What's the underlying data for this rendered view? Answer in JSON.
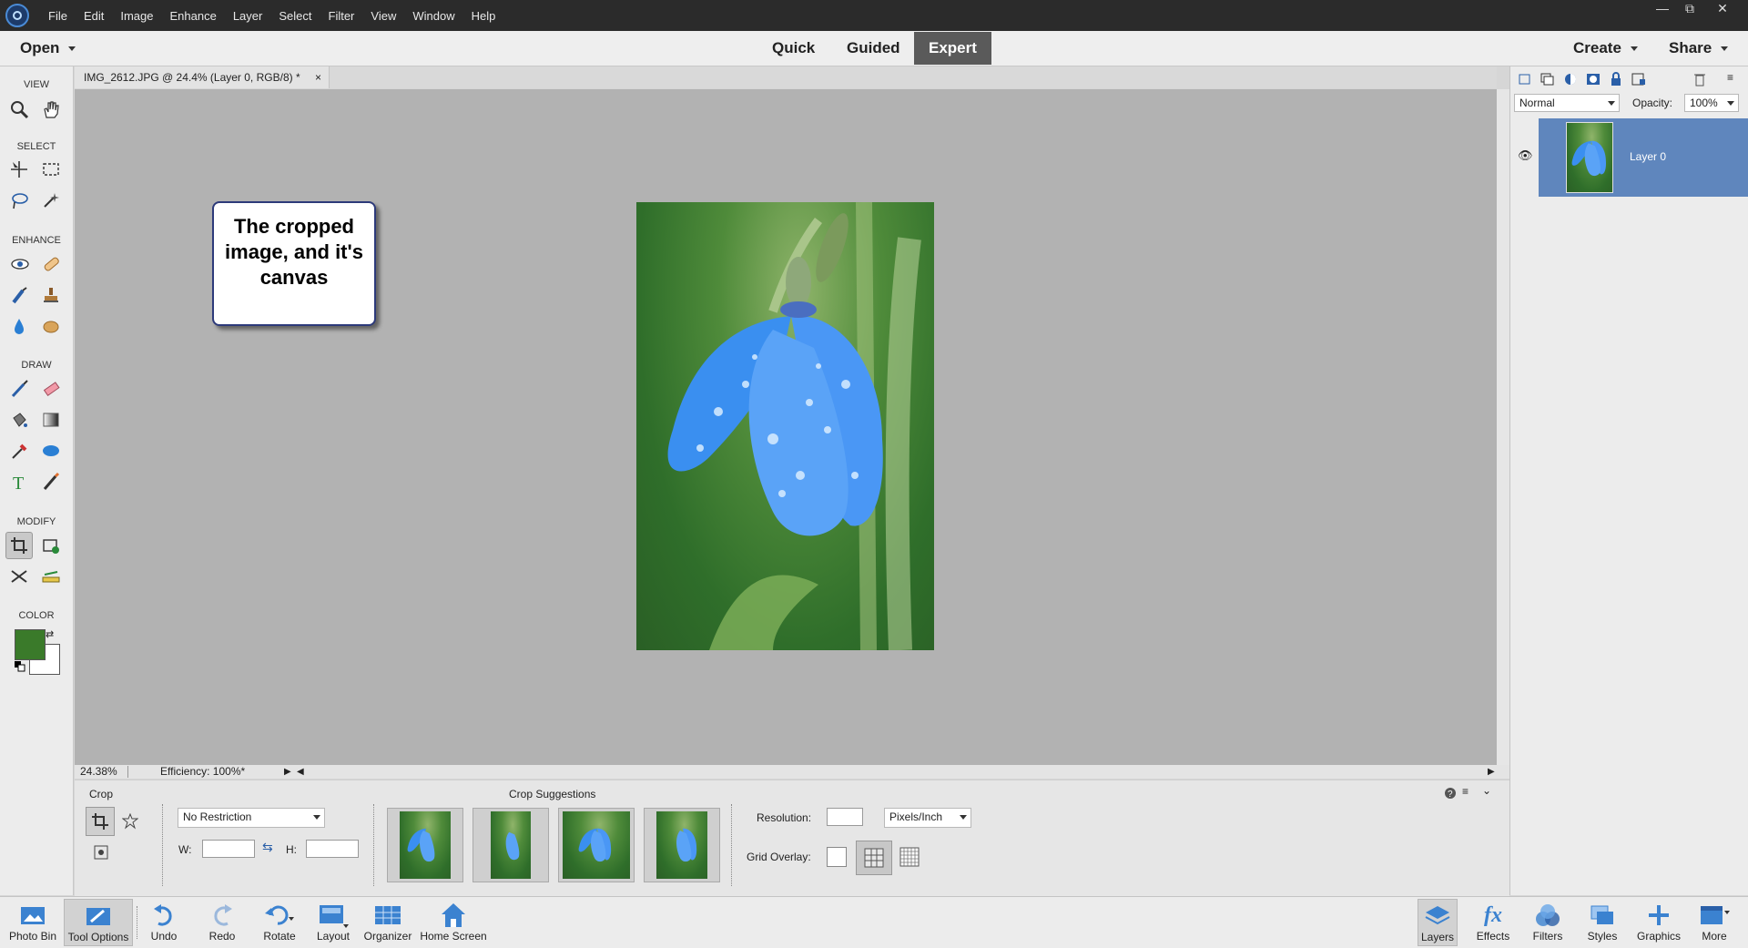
{
  "menubar": {
    "items": [
      "File",
      "Edit",
      "Image",
      "Enhance",
      "Layer",
      "Select",
      "Filter",
      "View",
      "Window",
      "Help"
    ],
    "window_controls": [
      "minimize",
      "restore",
      "close"
    ]
  },
  "modebar": {
    "open_label": "Open",
    "modes": [
      "Quick",
      "Guided",
      "Expert"
    ],
    "active_mode": "Expert",
    "create_label": "Create",
    "share_label": "Share"
  },
  "toolbox": {
    "sections": [
      "VIEW",
      "SELECT",
      "ENHANCE",
      "DRAW",
      "MODIFY",
      "COLOR"
    ],
    "foreground_color": "#3a7a2a",
    "background_color": "#ffffff"
  },
  "document": {
    "tab_title": "IMG_2612.JPG @ 24.4% (Layer 0, RGB/8) *",
    "zoom": "24.38%",
    "efficiency": "Efficiency: 100%*"
  },
  "callout": {
    "text": "The cropped image, and it's canvas"
  },
  "layers_panel": {
    "blend_mode": "Normal",
    "opacity_label": "Opacity:",
    "opacity_value": "100%",
    "layer_name": "Layer 0"
  },
  "tool_options": {
    "tool_name": "Crop",
    "suggestions_title": "Crop Suggestions",
    "restriction": "No Restriction",
    "width_label": "W:",
    "height_label": "H:",
    "resolution_label": "Resolution:",
    "resolution_unit": "Pixels/Inch",
    "grid_overlay_label": "Grid Overlay:"
  },
  "bottombar": {
    "left": [
      "Photo Bin",
      "Tool Options",
      "Undo",
      "Redo",
      "Rotate",
      "Layout",
      "Organizer",
      "Home Screen"
    ],
    "right": [
      "Layers",
      "Effects",
      "Filters",
      "Styles",
      "Graphics",
      "More"
    ]
  },
  "colors": {
    "accent": "#5a5a5a",
    "selection_blue": "#5f86bd",
    "canvas_gray": "#b2b2b2"
  }
}
